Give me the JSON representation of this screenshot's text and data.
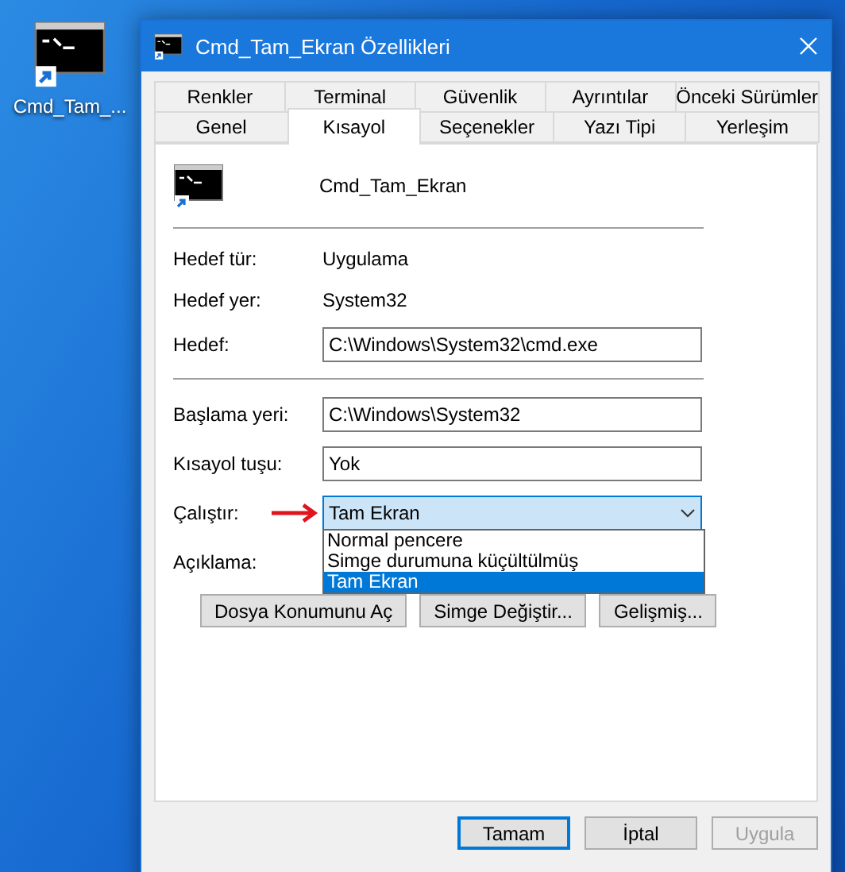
{
  "desktop_icon": {
    "label": "Cmd_Tam_..."
  },
  "window": {
    "title": "Cmd_Tam_Ekran Özellikleri"
  },
  "tab_rows": [
    {
      "tabs": [
        {
          "label": "Renkler",
          "selected": false
        },
        {
          "label": "Terminal",
          "selected": false
        },
        {
          "label": "Güvenlik",
          "selected": false
        },
        {
          "label": "Ayrıntılar",
          "selected": false
        },
        {
          "label": "Önceki Sürümler",
          "selected": false
        }
      ]
    },
    {
      "tabs": [
        {
          "label": "Genel",
          "selected": false
        },
        {
          "label": "Kısayol",
          "selected": true
        },
        {
          "label": "Seçenekler",
          "selected": false
        },
        {
          "label": "Yazı Tipi",
          "selected": false
        },
        {
          "label": "Yerleşim",
          "selected": false
        }
      ]
    }
  ],
  "shortcut": {
    "name": "Cmd_Tam_Ekran"
  },
  "info_rows": [
    {
      "kind": "text",
      "label": "Hedef tür:",
      "value": "Uygulama"
    },
    {
      "kind": "text",
      "label": "Hedef yer:",
      "value": "System32"
    },
    {
      "kind": "input",
      "label": "Hedef:",
      "value": "C:\\Windows\\System32\\cmd.exe"
    }
  ],
  "setting_rows": [
    {
      "kind": "input",
      "label": "Başlama yeri:",
      "value": "C:\\Windows\\System32"
    },
    {
      "kind": "input",
      "label": "Kısayol tuşu:",
      "value": "Yok"
    },
    {
      "kind": "combo",
      "label": "Çalıştır:",
      "value": "Tam Ekran",
      "pointed": true,
      "expanded": true,
      "options": [
        {
          "label": "Normal pencere",
          "selected": false
        },
        {
          "label": "Simge durumuna küçültülmüş",
          "selected": false
        },
        {
          "label": "Tam Ekran",
          "selected": true
        }
      ]
    },
    {
      "kind": "label",
      "label": "Açıklama:"
    }
  ],
  "action_buttons": [
    "Dosya Konumunu Aç",
    "Simge Değiştir...",
    "Gelişmiş..."
  ],
  "dialog_buttons": [
    {
      "label": "Tamam",
      "default": true,
      "disabled": false
    },
    {
      "label": "İptal",
      "default": false,
      "disabled": false
    },
    {
      "label": "Uygula",
      "default": false,
      "disabled": true
    }
  ]
}
